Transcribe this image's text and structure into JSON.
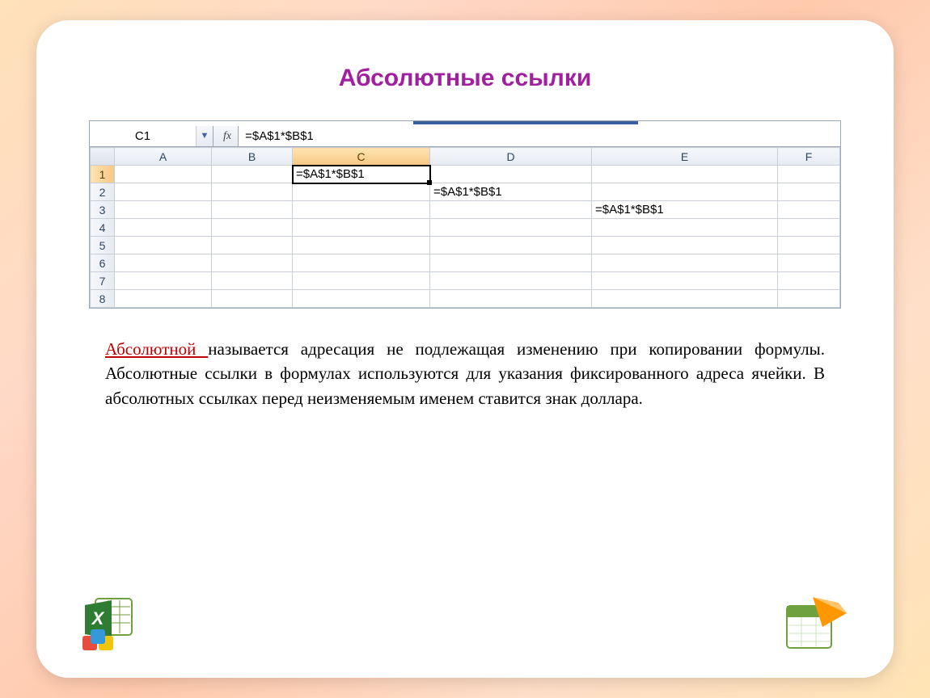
{
  "title": "Абсолютные ссылки",
  "formula_bar": {
    "cell_ref": "C1",
    "formula": "=$A$1*$B$1"
  },
  "columns": [
    {
      "label": "A",
      "class": "col-A",
      "selected": false
    },
    {
      "label": "B",
      "class": "col-B",
      "selected": false
    },
    {
      "label": "C",
      "class": "col-C",
      "selected": true
    },
    {
      "label": "D",
      "class": "col-D",
      "selected": false
    },
    {
      "label": "E",
      "class": "col-E",
      "selected": false
    },
    {
      "label": "F",
      "class": "col-F",
      "selected": false
    }
  ],
  "rows": [
    {
      "num": "1",
      "selected": true,
      "cells": [
        "",
        "",
        "=$A$1*$B$1",
        "",
        "",
        ""
      ],
      "selected_col": 2
    },
    {
      "num": "2",
      "selected": false,
      "cells": [
        "",
        "",
        "",
        "=$A$1*$B$1",
        "",
        ""
      ]
    },
    {
      "num": "3",
      "selected": false,
      "cells": [
        "",
        "",
        "",
        "",
        "=$A$1*$B$1",
        ""
      ]
    },
    {
      "num": "4",
      "selected": false,
      "cells": [
        "",
        "",
        "",
        "",
        "",
        ""
      ]
    },
    {
      "num": "5",
      "selected": false,
      "cells": [
        "",
        "",
        "",
        "",
        "",
        ""
      ]
    },
    {
      "num": "6",
      "selected": false,
      "cells": [
        "",
        "",
        "",
        "",
        "",
        ""
      ]
    },
    {
      "num": "7",
      "selected": false,
      "cells": [
        "",
        "",
        "",
        "",
        "",
        ""
      ]
    },
    {
      "num": "8",
      "selected": false,
      "cells": [
        "",
        "",
        "",
        "",
        "",
        ""
      ]
    }
  ],
  "paragraph": {
    "lead": "Абсолютной ",
    "rest": "называется адресация не подлежащая изменению при копировании формулы. Абсолютные ссылки в формулах используются для указания фиксированного адреса ячейки. В абсолютных ссылках перед неизменяемым именем ставится знак доллара."
  }
}
